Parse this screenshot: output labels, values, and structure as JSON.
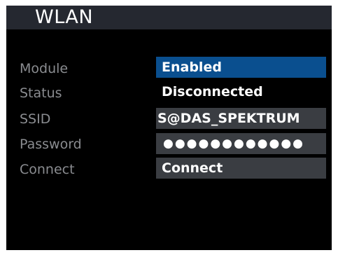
{
  "header": {
    "title": "WLAN"
  },
  "settings": {
    "module": {
      "label": "Module",
      "value": "Enabled"
    },
    "status": {
      "label": "Status",
      "value": "Disconnected"
    },
    "ssid": {
      "label": "SSID",
      "value": "S@DAS_SPEKTRUM"
    },
    "password": {
      "label": "Password",
      "value": "●●●●●●●●●●●●"
    },
    "connect": {
      "label": "Connect",
      "value": "Connect"
    }
  },
  "colors": {
    "selected_background": "#0a4f8f",
    "field_background": "#3a3d42",
    "title_bar_background": "#252830",
    "label_text": "#8a8c90"
  }
}
